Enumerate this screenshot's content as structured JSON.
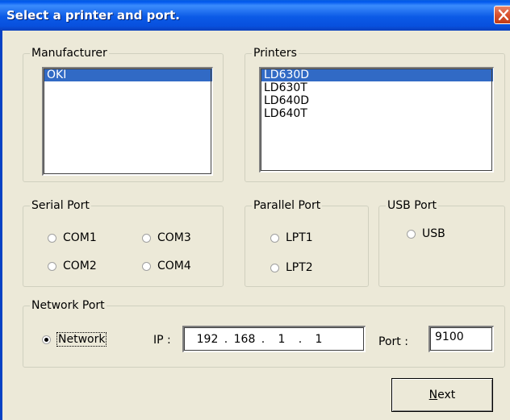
{
  "window": {
    "title": "Select a printer and port."
  },
  "manufacturer": {
    "legend": "Manufacturer",
    "items": [
      "OKI"
    ],
    "selected_index": 0
  },
  "printers": {
    "legend": "Printers",
    "items": [
      "LD630D",
      "LD630T",
      "LD640D",
      "LD640T"
    ],
    "selected_index": 0
  },
  "serial_port": {
    "legend": "Serial Port",
    "options": [
      "COM1",
      "COM3",
      "COM2",
      "COM4"
    ]
  },
  "parallel_port": {
    "legend": "Parallel Port",
    "options": [
      "LPT1",
      "LPT2"
    ]
  },
  "usb_port": {
    "legend": "USB Port",
    "option": "USB"
  },
  "network_port": {
    "legend": "Network Port",
    "option": "Network",
    "checked": true,
    "ip_label": "IP :",
    "ip": [
      "192",
      "168",
      "1",
      "1"
    ],
    "port_label": "Port :",
    "port_value": "9100"
  },
  "buttons": {
    "next_prefix": "N",
    "next_rest": "ext"
  },
  "icons": {
    "close": "close-icon"
  },
  "colors": {
    "title_bar": "#0b5ae6",
    "selection": "#316ac5",
    "dialog_bg": "#ece9d8"
  }
}
